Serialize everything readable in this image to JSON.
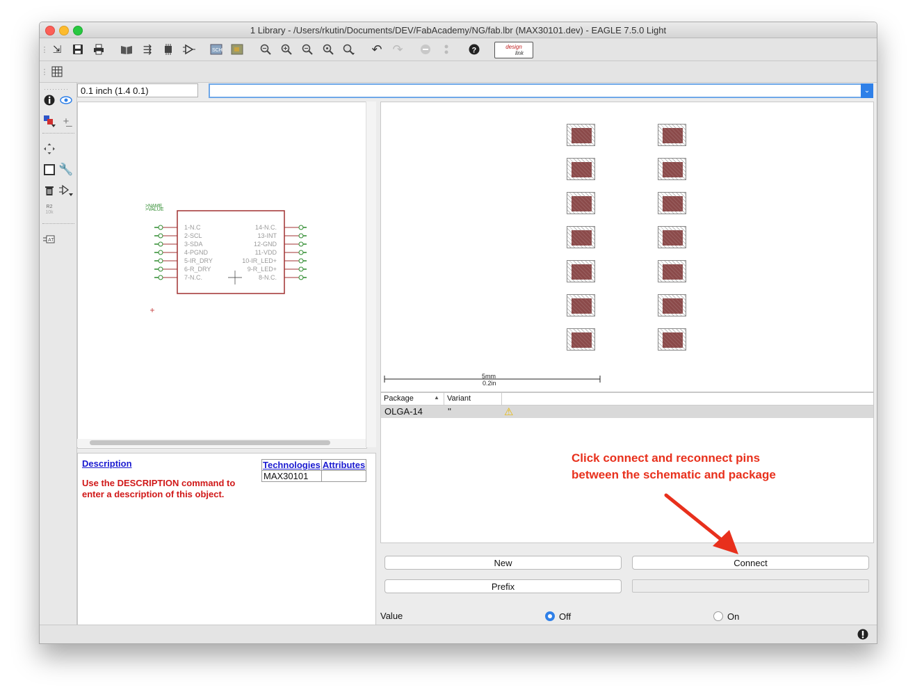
{
  "window": {
    "title": "1 Library - /Users/rkutin/Documents/DEV/FabAcademy/NG/fab.lbr (MAX30101.dev) - EAGLE 7.5.0 Light"
  },
  "toolbar": {
    "design_link_label_top": "design",
    "design_link_label_bottom": "link",
    "sch_label": "SCH",
    "brd_label": "BRD"
  },
  "coordinates": "0.1 inch (1.4 0.1)",
  "command_input": {
    "value": ""
  },
  "schematic": {
    "name_label": ">NAME",
    "value_label": ">VALUE",
    "left_pins": [
      "1-N.C",
      "2-SCL",
      "3-SDA",
      "4-PGND",
      "5-IR_DRY",
      "6-R_DRY",
      "7-N.C."
    ],
    "right_pins": [
      "14-N.C.",
      "13-INT",
      "12-GND",
      "11-VDD",
      "10-IR_LED+",
      "9-R_LED+",
      "8-N.C."
    ]
  },
  "info_panel": {
    "description_link": "Description",
    "description_text": "Use the DESCRIPTION command to enter a description of this object.",
    "technologies_header": "Technologies",
    "attributes_header": "Attributes",
    "technology_row": "MAX30101",
    "attribute_row": ""
  },
  "package_view": {
    "scale_mm": "5mm",
    "scale_in": "0.2in"
  },
  "variants": {
    "col_package": "Package",
    "col_variant": "Variant",
    "sort_indicator": "▲",
    "rows": [
      {
        "package": "OLGA-14",
        "variant": "''",
        "warning": "⚠"
      }
    ]
  },
  "buttons": {
    "new": "New",
    "connect": "Connect",
    "prefix": "Prefix"
  },
  "value_setting": {
    "label": "Value",
    "off_label": "Off",
    "on_label": "On",
    "selected": "Off"
  },
  "annotation": {
    "text": "Click connect and reconnect pins between the schematic and package",
    "color": "#e8301c"
  },
  "colors": {
    "pad_fill": "#8b4a4a",
    "symbol_outline": "#a03030",
    "pin_green": "#2e8b2e",
    "accent_blue": "#2f80e8"
  }
}
